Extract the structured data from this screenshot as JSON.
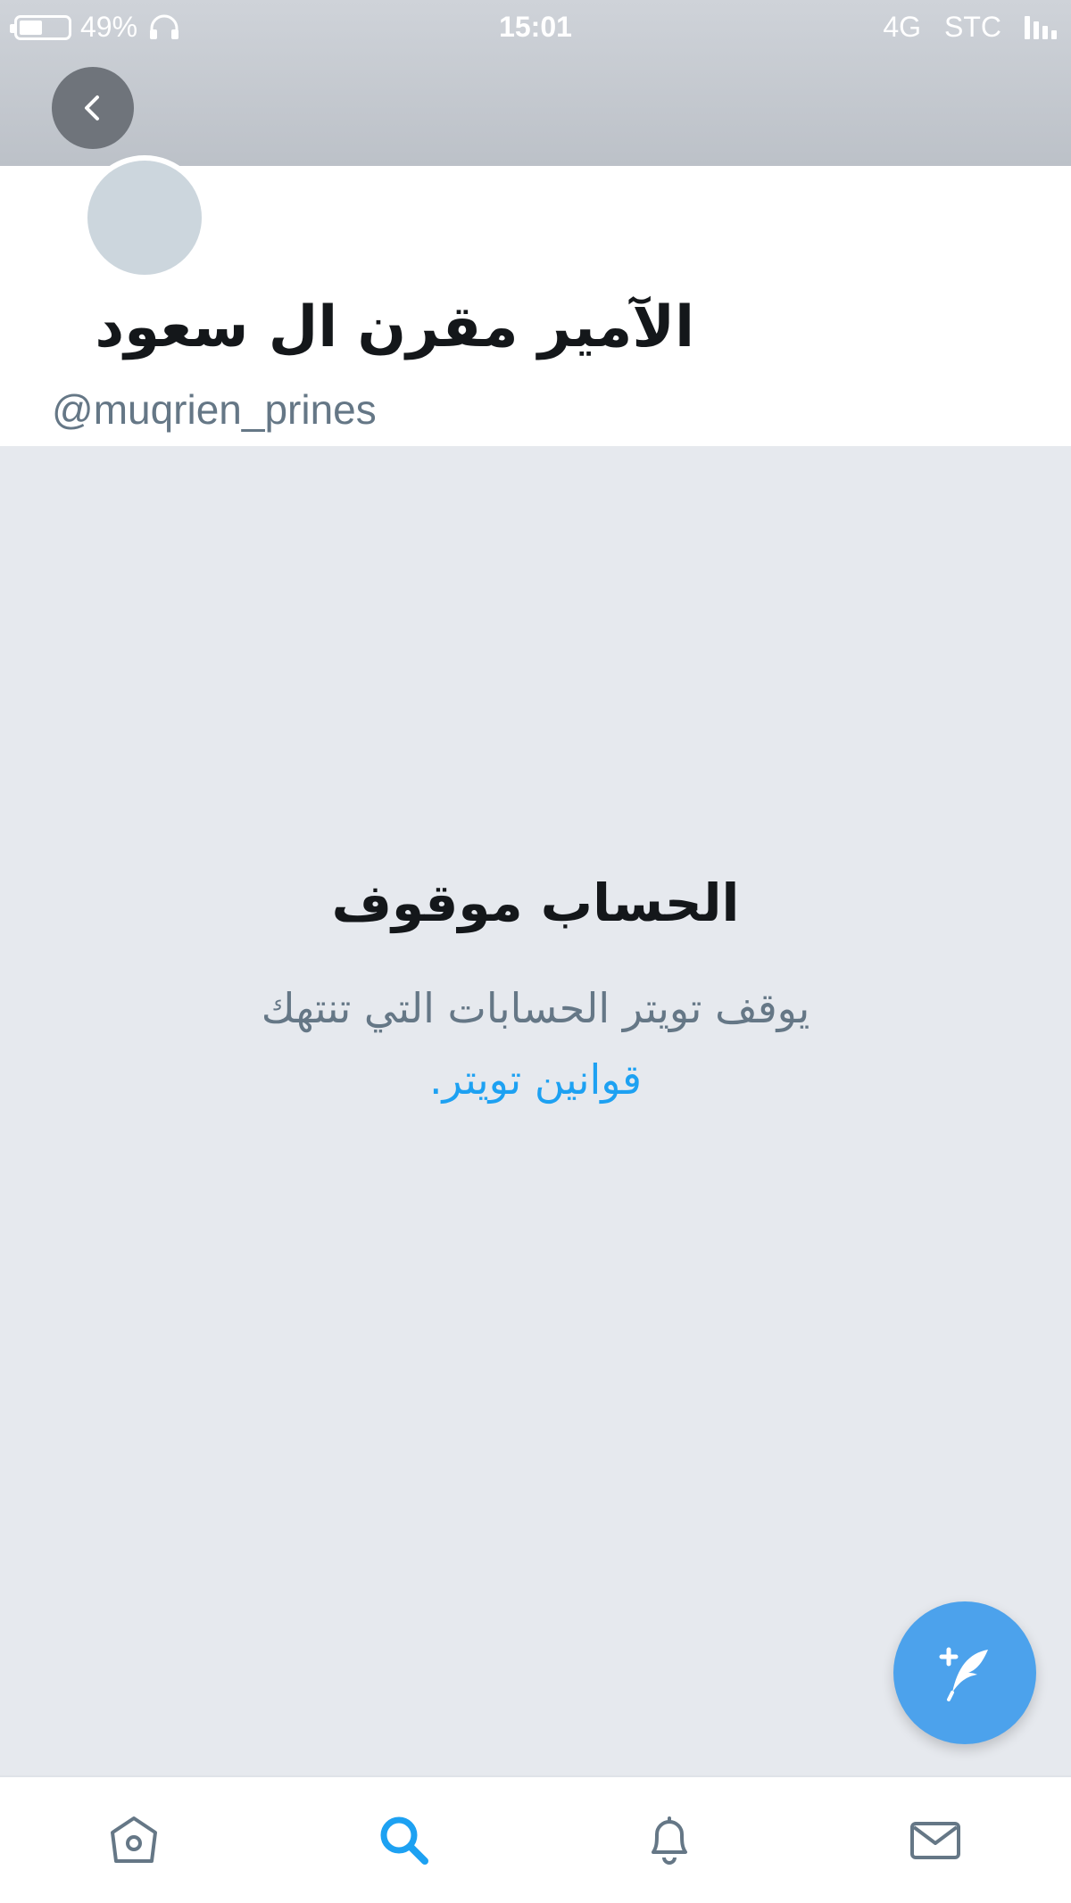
{
  "status_bar": {
    "battery_percent": "49%",
    "battery_level": 0.49,
    "time": "15:01",
    "network": "4G",
    "carrier": "STC"
  },
  "header": {
    "back_icon": "chevron-left-icon"
  },
  "profile": {
    "display_name": "الآمير مقرن ال سعود",
    "handle": "@muqrien_prines"
  },
  "suspended": {
    "title": "الحساب موقوف",
    "body": "يوقف تويتر الحسابات التي تنتهك",
    "link": "قوانين تويتر."
  },
  "compose": {
    "icon": "compose-tweet-icon"
  },
  "tab_bar": {
    "items": [
      {
        "name": "home",
        "icon": "home-icon",
        "active": false
      },
      {
        "name": "search",
        "icon": "search-icon",
        "active": true
      },
      {
        "name": "notifications",
        "icon": "bell-icon",
        "active": false
      },
      {
        "name": "messages",
        "icon": "mail-icon",
        "active": false
      }
    ]
  },
  "colors": {
    "accent": "#1da1f2",
    "fab": "#4ca2ec",
    "inactive_icon": "#657786",
    "background": "#e6e9ee"
  }
}
